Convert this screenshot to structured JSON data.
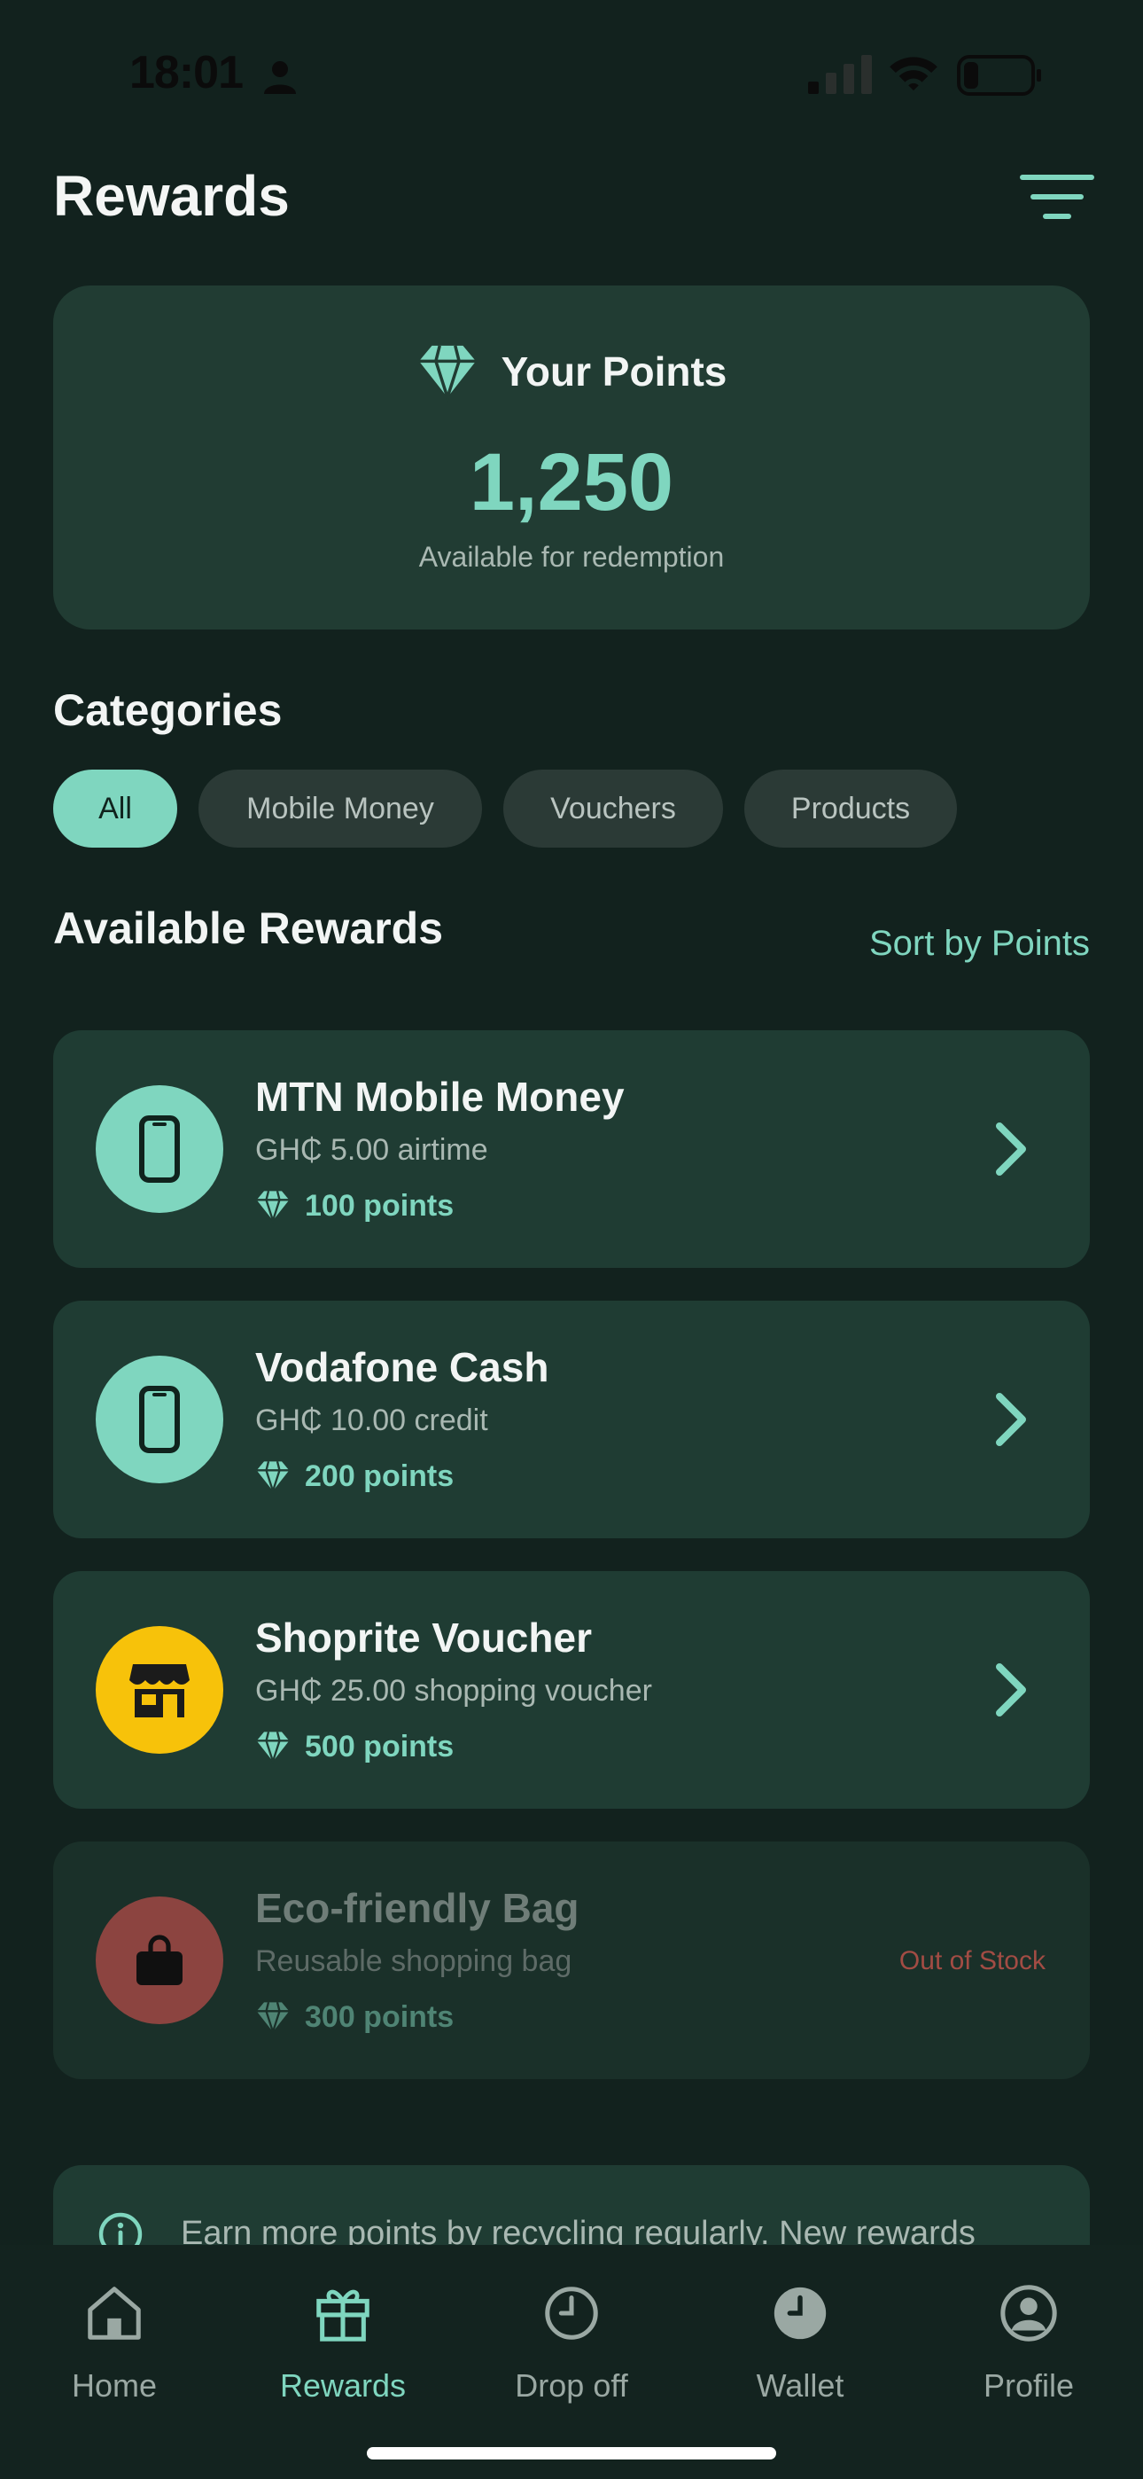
{
  "status_bar": {
    "time": "18:01"
  },
  "header": {
    "title": "Rewards"
  },
  "points_card": {
    "label": "Your Points",
    "value": "1,250",
    "subtitle": "Available for redemption"
  },
  "categories": {
    "title": "Categories",
    "chips": [
      "All",
      "Mobile Money",
      "Vouchers",
      "Products"
    ],
    "selected": "All"
  },
  "available": {
    "title": "Available Rewards",
    "sort_label": "Sort by Points"
  },
  "rewards": [
    {
      "title": "MTN Mobile Money",
      "description": "GH₵ 5.00 airtime",
      "points": "100 points",
      "icon": "phone-icon",
      "icon_color": "#7fd6bf"
    },
    {
      "title": "Vodafone Cash",
      "description": "GH₵ 10.00 credit",
      "points": "200 points",
      "icon": "phone-icon",
      "icon_color": "#7fd6bf"
    },
    {
      "title": "Shoprite Voucher",
      "description": "GH₵ 25.00 shopping voucher",
      "points": "500 points",
      "icon": "store-icon",
      "icon_color": "#f7c20a"
    },
    {
      "title": "Eco-friendly Bag",
      "description": "Reusable shopping bag",
      "points": "300 points",
      "icon": "bag-icon",
      "icon_color": "#8c4440",
      "status": "Out of Stock"
    }
  ],
  "info_banner": {
    "text": "Earn more points by recycling regularly. New rewards"
  },
  "bottom_nav": {
    "items": [
      "Home",
      "Rewards",
      "Drop off",
      "Wallet",
      "Profile"
    ],
    "active": "Rewards"
  },
  "colors": {
    "accent": "#7fd6bf",
    "background": "#12221e",
    "card": "#213c33",
    "warning": "#a24c44"
  }
}
